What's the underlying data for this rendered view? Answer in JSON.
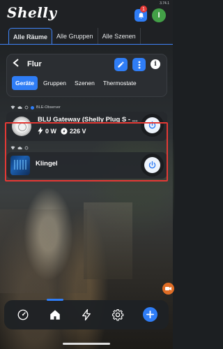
{
  "app": {
    "logo": "Shelly",
    "version": "3.74.1",
    "notifications_count": "1",
    "avatar_initial": "I"
  },
  "tabs": [
    {
      "label": "Alle Räume",
      "active": true
    },
    {
      "label": "Alle Gruppen",
      "active": false
    },
    {
      "label": "Alle Szenen",
      "active": false
    }
  ],
  "room": {
    "title": "Flur",
    "subtabs": [
      {
        "label": "Geräte",
        "active": true
      },
      {
        "label": "Gruppen",
        "active": false
      },
      {
        "label": "Szenen",
        "active": false
      },
      {
        "label": "Thermostate",
        "active": false
      }
    ]
  },
  "devices": [
    {
      "meta_label": "BLE-Observer",
      "name": "BLU Gateway (Shelly Plug S - ...",
      "power": "0 W",
      "voltage": "226 V",
      "icon": "plug-icon"
    },
    {
      "meta_label": "",
      "name": "Klingel",
      "icon": "doorbell-icon",
      "highlighted": true
    }
  ],
  "bottom_nav": [
    "dashboard-icon",
    "home-icon",
    "energy-icon",
    "settings-icon",
    "add-icon"
  ],
  "colors": {
    "accent": "#2f7df6",
    "highlight": "#e53935",
    "avatar": "#43a047"
  }
}
